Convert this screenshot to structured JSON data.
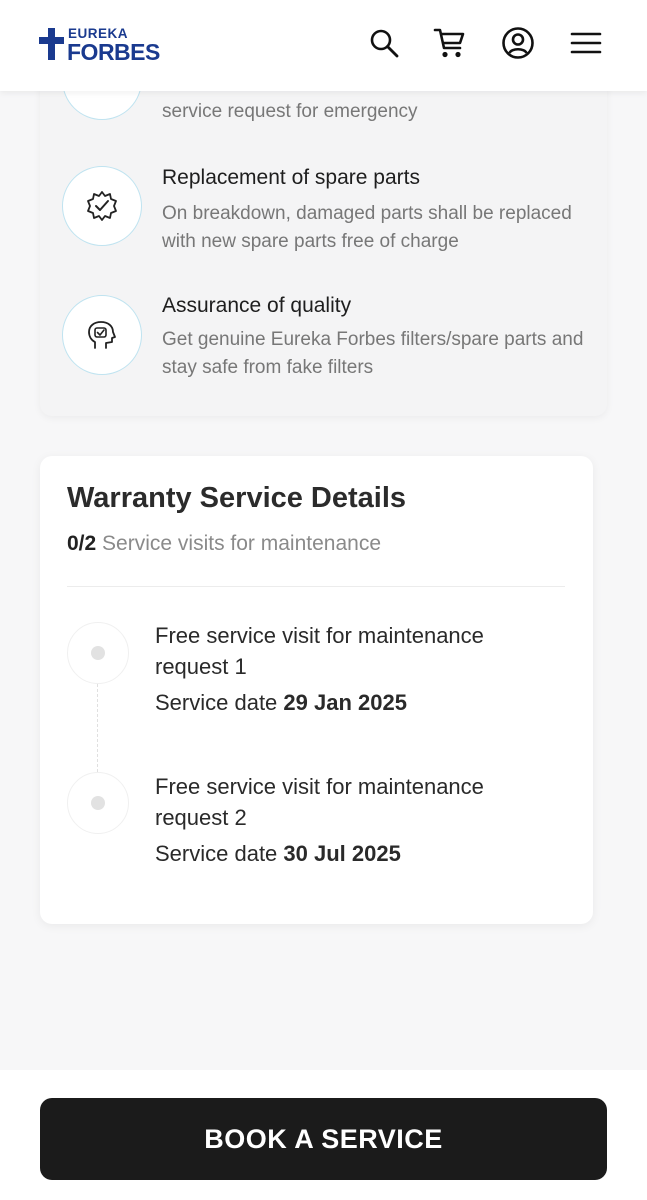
{
  "header": {
    "logo_top": "EUREKA",
    "logo_bottom": "FORBES",
    "icons": [
      "search-icon",
      "cart-icon",
      "account-icon",
      "menu-icon"
    ]
  },
  "benefits": {
    "items": [
      {
        "icon": "emergency-icon",
        "title": "",
        "desc_line2": "service request for emergency"
      },
      {
        "icon": "gear-check-icon",
        "title": "Replacement of spare parts",
        "desc": "On breakdown, damaged parts shall be replaced with new spare parts free of charge"
      },
      {
        "icon": "quality-badge-icon",
        "title": "Assurance of quality",
        "desc": "Get genuine Eureka Forbes filters/spare parts and stay safe from fake filters"
      }
    ]
  },
  "warranty": {
    "title": "Warranty Service Details",
    "visits_done": "0/2",
    "visits_label": "Service visits for maintenance",
    "visits": [
      {
        "title": "Free service visit for maintenance request 1",
        "date_label": "Service date",
        "date": "29 Jan 2025"
      },
      {
        "title": "Free service visit for maintenance request 2",
        "date_label": "Service date",
        "date": "30 Jul 2025"
      }
    ]
  },
  "footer": {
    "book_button": "BOOK A SERVICE"
  },
  "colors": {
    "brand_blue": "#1a3a8f",
    "button_bg": "#1b1b1b",
    "icon_ring": "#bfe3f0"
  }
}
